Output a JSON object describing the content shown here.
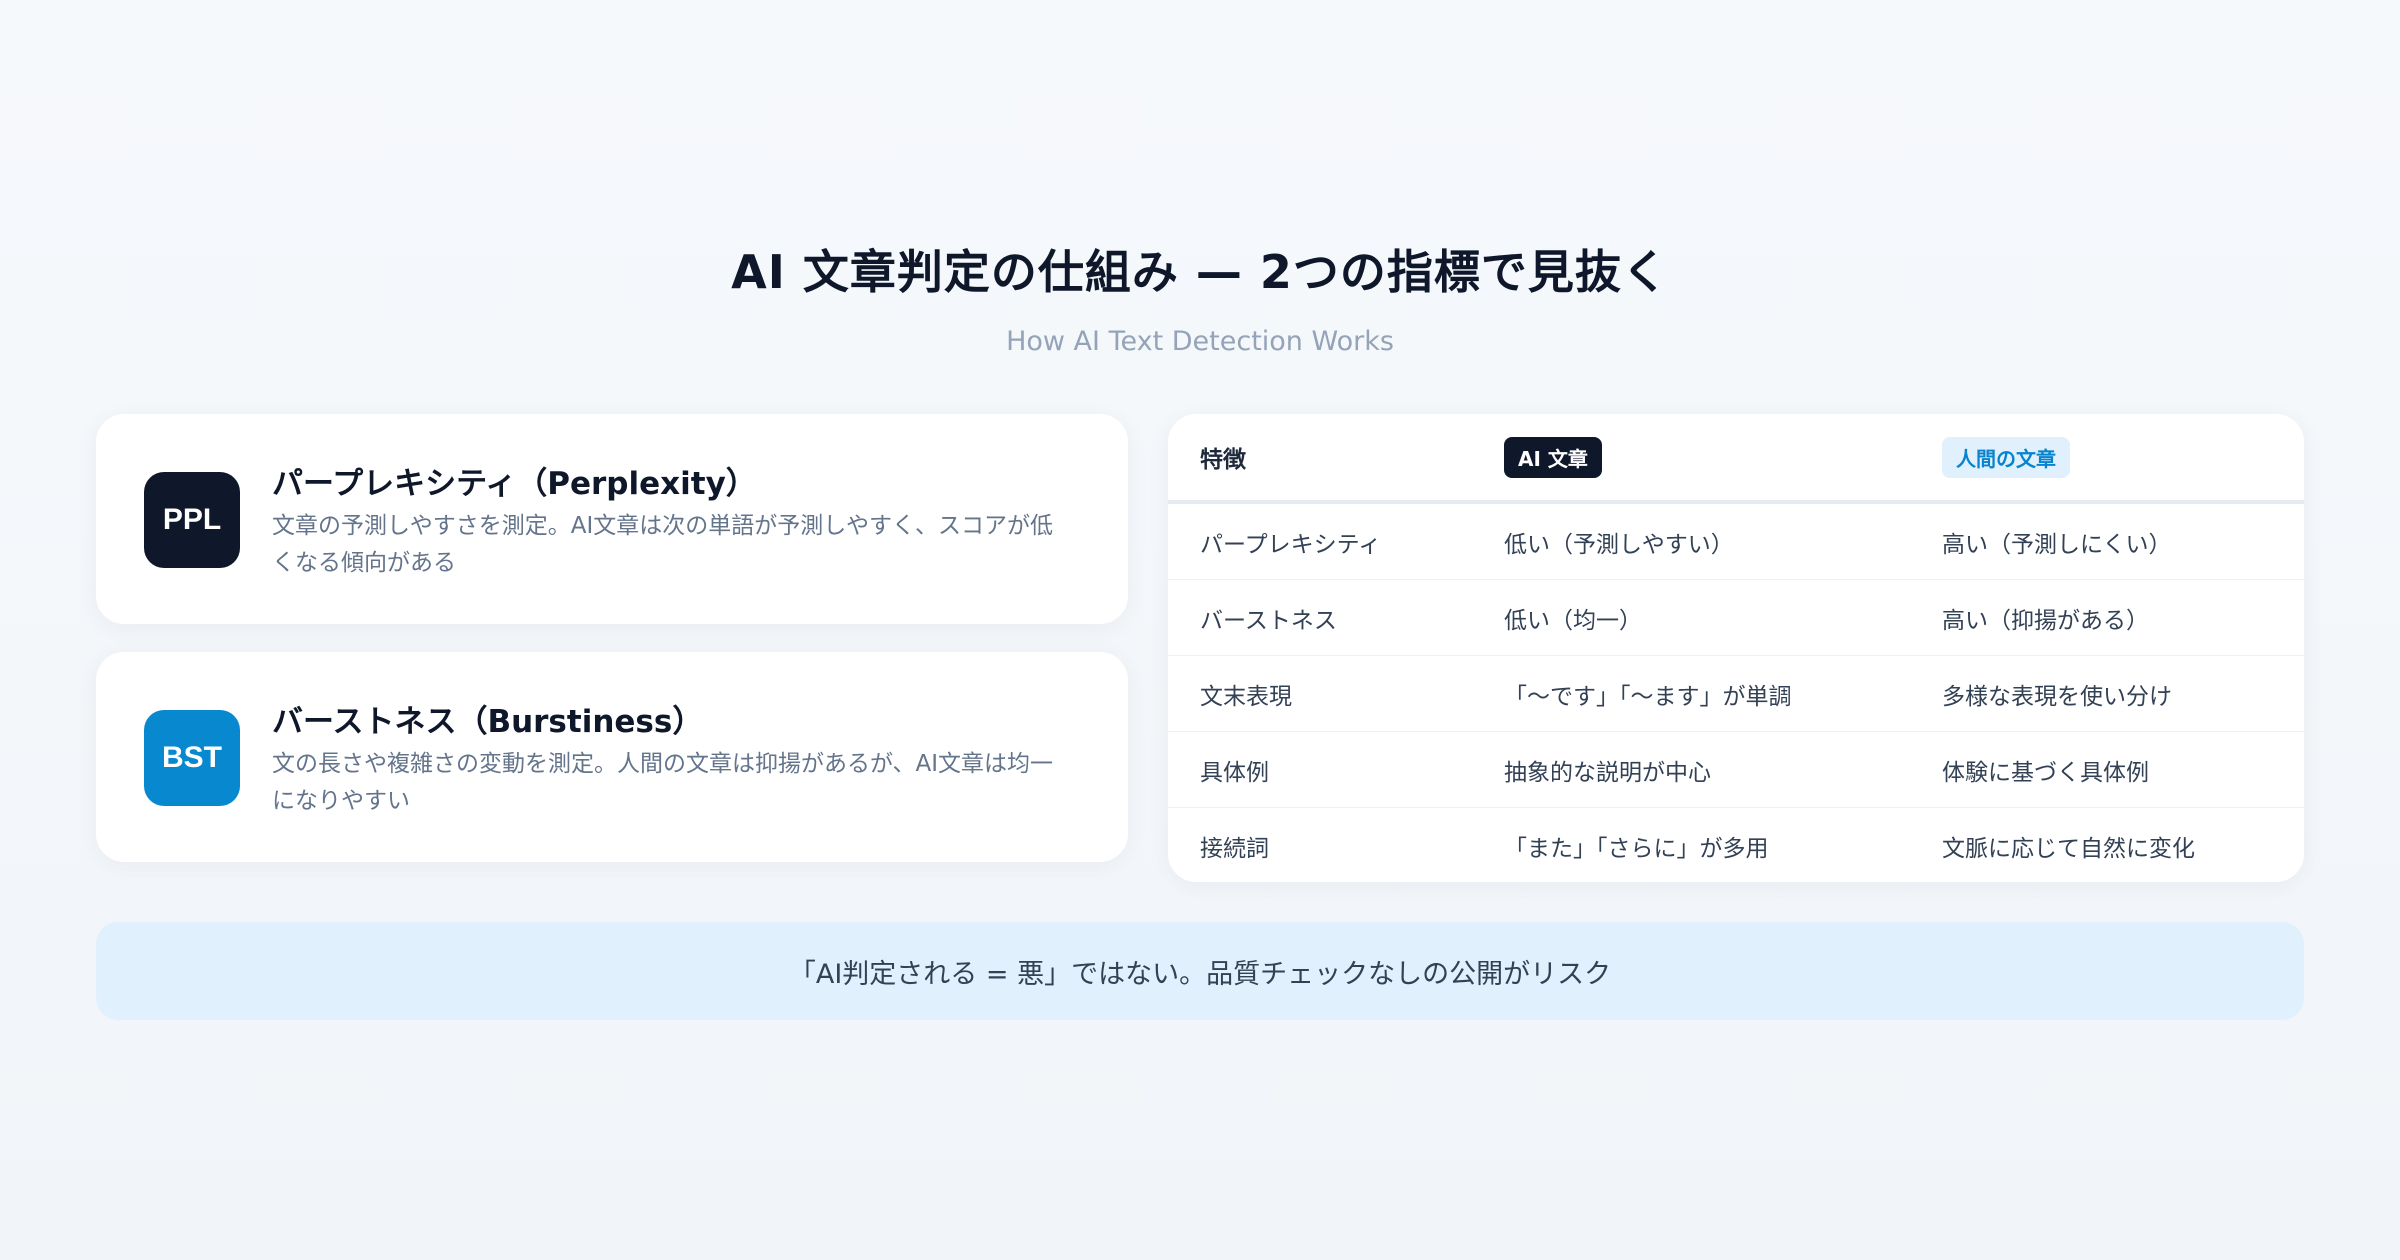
{
  "header": {
    "title": "AI 文章判定の仕組み — 2つの指標で見抜く",
    "subtitle": "How AI Text Detection Works"
  },
  "cards": [
    {
      "badge": "PPL",
      "badge_color": "#0f172a",
      "title": "パープレキシティ（Perplexity）",
      "description": "文章の予測しやすさを測定。AI文章は次の単語が予測しやすく、スコアが低くなる傾向がある"
    },
    {
      "badge": "BST",
      "badge_color": "#0888cf",
      "title": "バーストネス（Burstiness）",
      "description": "文の長さや複雑さの変動を測定。人間の文章は抑揚があるが、AI文章は均一になりやすい"
    }
  ],
  "table": {
    "headers": [
      "特徴",
      "AI 文章",
      "人間の文章"
    ],
    "rows": [
      [
        "パープレキシティ",
        "低い（予測しやすい）",
        "高い（予測しにくい）"
      ],
      [
        "バーストネス",
        "低い（均一）",
        "高い（抑揚がある）"
      ],
      [
        "文末表現",
        "「〜です」「〜ます」が単調",
        "多様な表現を使い分け"
      ],
      [
        "具体例",
        "抽象的な説明が中心",
        "体験に基づく具体例"
      ],
      [
        "接続詞",
        "「また」「さらに」が多用",
        "文脈に応じて自然に変化"
      ]
    ]
  },
  "footer": {
    "text": "「AI判定される = 悪」ではない。品質チェックなしの公開がリスク"
  },
  "colors": {
    "dark": "#0f172a",
    "accent_blue": "#0888cf",
    "light_blue_bg": "#e0f0fc"
  }
}
